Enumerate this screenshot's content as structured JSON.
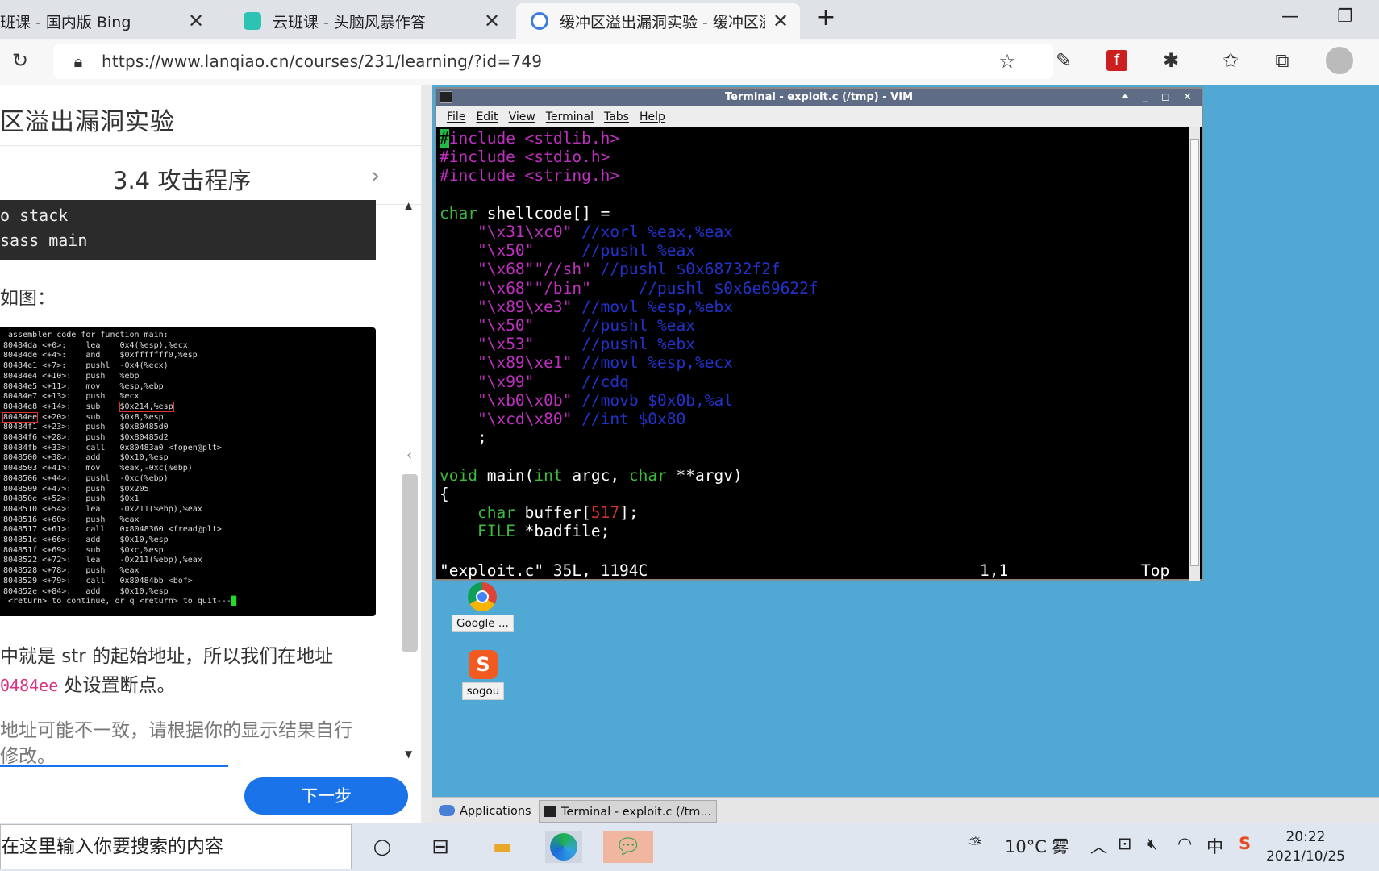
{
  "browser": {
    "tabs": [
      {
        "title": "班课 - 国内版 Bing"
      },
      {
        "title": "云班课 - 头脑风暴作答"
      },
      {
        "title": "缓冲区溢出漏洞实验 - 缓冲区溢出"
      }
    ],
    "new_tab": "+",
    "url": "https://www.lanqiao.cn/courses/231/learning/?id=749"
  },
  "course": {
    "title": "区溢出漏洞实验",
    "section": "3.4 攻击程序",
    "code_lines": [
      "o stack",
      "sass main"
    ],
    "para_figure": "如图：",
    "para_addr_1": "中就是 str 的起始地址，所以我们在地址",
    "para_addr_2_code": "0484ee",
    "para_addr_2_text": " 处设置断点。",
    "note_1": "地址可能不一致，请根据你的显示结果自行",
    "note_2": "修改。",
    "next_label": "下一步"
  },
  "gdb_lines": [
    " assembler code for function main:",
    "80484da <+0>:    lea    0x4(%esp),%ecx",
    "80484de <+4>:    and    $0xfffffff0,%esp",
    "80484e1 <+7>:    pushl  -0x4(%ecx)",
    "80484e4 <+10>:   push   %ebp",
    "80484e5 <+11>:   mov    %esp,%ebp",
    "80484e7 <+13>:   push   %ecx",
    "80484e8 <+14>:   sub    $0x214,%esp",
    "80484ee <+20>:   sub    $0x8,%esp",
    "80484f1 <+23>:   push   $0x80485d0",
    "80484f6 <+28>:   push   $0x80485d2",
    "80484fb <+33>:   call   0x80483a0 <fopen@plt>",
    "8048500 <+38>:   add    $0x10,%esp",
    "8048503 <+41>:   mov    %eax,-0xc(%ebp)",
    "8048506 <+44>:   pushl  -0xc(%ebp)",
    "8048509 <+47>:   push   $0x205",
    "804850e <+52>:   push   $0x1",
    "8048510 <+54>:   lea    -0x211(%ebp),%eax",
    "8048516 <+60>:   push   %eax",
    "8048517 <+61>:   call   0x8048360 <fread@plt>",
    "804851c <+66>:   add    $0x10,%esp",
    "804851f <+69>:   sub    $0xc,%esp",
    "8048522 <+72>:   lea    -0x211(%ebp),%eax",
    "8048528 <+78>:   push   %eax",
    "8048529 <+79>:   call   0x80484bb <bof>",
    "804852e <+84>:   add    $0x10,%esp",
    " <return> to continue, or q <return> to quit---"
  ],
  "vim": {
    "title": "Terminal - exploit.c (/tmp) - VIM",
    "menu": [
      "File",
      "Edit",
      "View",
      "Terminal",
      "Tabs",
      "Help"
    ],
    "status_left": "\"exploit.c\" 35L, 1194C",
    "status_pos": "1,1",
    "status_right": "Top"
  },
  "desktop_icons": [
    {
      "label": "Google ..."
    },
    {
      "label": "sogou"
    }
  ],
  "xfce_panel": {
    "applications": "Applications",
    "task": "Terminal - exploit.c (/tm..."
  },
  "taskbar": {
    "search_placeholder": "在这里输入你要搜索的内容",
    "weather": "10°C 雾",
    "ime": "中",
    "time": "20:22",
    "date": "2021/10/25"
  },
  "colors": {
    "accent": "#1a73e8",
    "desktop": "#4fa9d4",
    "vim_titlebar": "#5e6c86"
  }
}
